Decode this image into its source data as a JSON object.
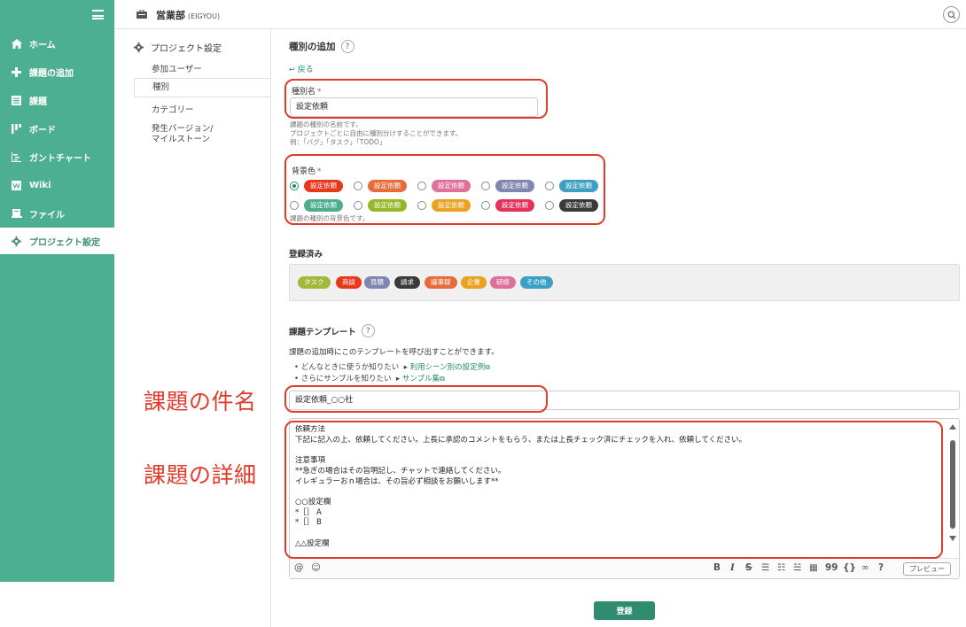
{
  "colors": {
    "accent": "#4caf8f",
    "annotation": "#e03c2c",
    "link": "#1f8a70"
  },
  "header": {
    "project_name": "営業部",
    "project_key": "(EIGYOU)"
  },
  "sidebar": {
    "items": [
      {
        "label": "ホーム",
        "icon": "home-icon"
      },
      {
        "label": "課題の追加",
        "icon": "plus-icon"
      },
      {
        "label": "課題",
        "icon": "list-icon"
      },
      {
        "label": "ボード",
        "icon": "board-icon"
      },
      {
        "label": "ガントチャート",
        "icon": "gantt-icon"
      },
      {
        "label": "Wiki",
        "icon": "wiki-icon"
      },
      {
        "label": "ファイル",
        "icon": "folder-icon"
      },
      {
        "label": "プロジェクト設定",
        "icon": "gear-icon"
      }
    ]
  },
  "subnav": {
    "title": "プロジェクト設定",
    "items": [
      {
        "label": "参加ユーザー"
      },
      {
        "label": "種別"
      },
      {
        "label": "カテゴリー"
      },
      {
        "label": "発生バージョン/",
        "label2": "マイルストーン"
      }
    ]
  },
  "form": {
    "title": "種別の追加",
    "help": "?",
    "back": "戻る",
    "name_label": "種別名",
    "required_mark": "*",
    "name_value": "設定依頼",
    "name_hint_1": "課題の種別の名前です。",
    "name_hint_2": "プロジェクトごとに自由に種別分けすることができます。",
    "name_hint_3": "例：「バグ」「タスク」「TODO」",
    "color_label": "背景色",
    "color_hint": "課題の種別の背景色です。",
    "color_options": [
      {
        "text": "設定依頼",
        "color": "#e8381c",
        "checked": true
      },
      {
        "text": "設定依頼",
        "color": "#e86c3a"
      },
      {
        "text": "設定依頼",
        "color": "#e0709b"
      },
      {
        "text": "設定依頼",
        "color": "#8086b2"
      },
      {
        "text": "設定依頼",
        "color": "#3c9fc4"
      },
      {
        "text": "設定依頼",
        "color": "#4dae8f"
      },
      {
        "text": "設定依頼",
        "color": "#95b827"
      },
      {
        "text": "設定依頼",
        "color": "#eba221"
      },
      {
        "text": "設定依頼",
        "color": "#e6325a"
      },
      {
        "text": "設定依頼",
        "color": "#393939"
      }
    ]
  },
  "registered": {
    "title": "登録済み",
    "types": [
      {
        "text": "タスク",
        "color": "#a2b93b"
      },
      {
        "text": "商談",
        "color": "#e8381c"
      },
      {
        "text": "見積",
        "color": "#8086b2"
      },
      {
        "text": "請求",
        "color": "#393939"
      },
      {
        "text": "議事録",
        "color": "#e86c3a"
      },
      {
        "text": "企業",
        "color": "#eba221"
      },
      {
        "text": "研修",
        "color": "#e0709b"
      },
      {
        "text": "その他",
        "color": "#3c9fc4"
      }
    ]
  },
  "template": {
    "title": "課題テンプレート",
    "help": "?",
    "description": "課題の追加時にこのテンプレートを呼び出すことができます。",
    "bullet1_text": "どんなときに使うか知りたい",
    "bullet1_link": "利用シーン別の設定例",
    "bullet2_text": "さらにサンプルを知りたい",
    "bullet2_link": "サンプル集",
    "subject_value": "設定依頼_○○社",
    "body": "依頼方法\n下記に記入の上、依頼してください。上長に承認のコメントをもらう、または上長チェック済にチェックを入れ、依頼してください。\n\n注意事項\n**急ぎの場合はその旨明記し、チャットで連絡してください。\nイレギュラーおｎ場合は、その旨必ず相談をお願いします**\n\n○○設定欄\n*［］ A\n*［］ B\n\n△△設定欄",
    "preview": "プレビュー"
  },
  "toolbar": {
    "bold": "B",
    "italic": "I",
    "strike": "S",
    "quote": "99",
    "code": "{}",
    "help": "?"
  },
  "annotations": {
    "subject": "課題の件名",
    "detail": "課題の詳細"
  },
  "submit": "登録"
}
